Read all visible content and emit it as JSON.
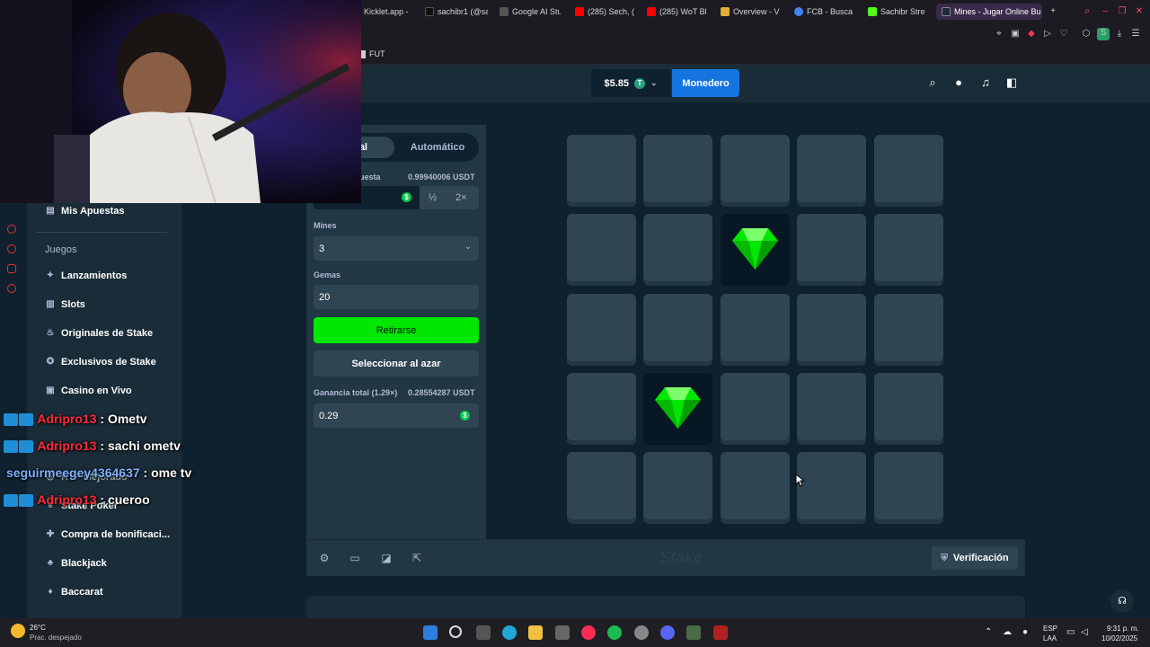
{
  "browser": {
    "tabs": [
      {
        "label": "Kicklet.app -"
      },
      {
        "label": "sachibr1 (@sa"
      },
      {
        "label": "Google AI Stu"
      },
      {
        "label": "(285) Sech, (("
      },
      {
        "label": "(285) WoT Bl"
      },
      {
        "label": "Overview - V"
      },
      {
        "label": "FCB - Busca"
      },
      {
        "label": "Sachibr Stre"
      },
      {
        "label": "Mines - Jugar Online Bu"
      }
    ],
    "bookmark": "FUT"
  },
  "header": {
    "balance": "$5.85",
    "wallet_label": "Monedero"
  },
  "sidebar": {
    "my_bets": "Mis Apuestas",
    "section": "Juegos",
    "items": [
      {
        "label": "Lanzamientos"
      },
      {
        "label": "Slots"
      },
      {
        "label": "Originales de Stake"
      },
      {
        "label": "Exclusivos de Stake"
      },
      {
        "label": "Casino en Vivo"
      },
      {
        "label": "RTP Mejorado"
      },
      {
        "label": "Stake Poker"
      },
      {
        "label": "Compra de bonificaci..."
      },
      {
        "label": "Blackjack"
      },
      {
        "label": "Baccarat"
      }
    ]
  },
  "game": {
    "mode_manual": "ual",
    "mode_auto": "Automático",
    "bet_label": "uesta",
    "bet_amount": "0.99940006 USDT",
    "half": "½",
    "double": "2×",
    "mines_label": "Mines",
    "mines_value": "3",
    "gems_label": "Gemas",
    "gems_value": "20",
    "cashout": "Retirarse",
    "random": "Seleccionar al azar",
    "profit_label": "Ganancia total (1.29×)",
    "profit_amount": "0.28554287 USDT",
    "profit_value": "0.29",
    "verify": "Verificación",
    "watermark": "Stake",
    "grid": [
      [
        0,
        0,
        0,
        0,
        0
      ],
      [
        0,
        0,
        1,
        0,
        0
      ],
      [
        0,
        0,
        0,
        0,
        0
      ],
      [
        0,
        1,
        0,
        0,
        0
      ],
      [
        0,
        0,
        0,
        0,
        0
      ]
    ]
  },
  "chat": [
    {
      "user": "Adripro13",
      "msg": "Ometv"
    },
    {
      "user": "Adripro13",
      "msg": "sachi ometv"
    },
    {
      "user": "seguirmeegey4364637",
      "msg": "ome tv"
    },
    {
      "user": "Adripro13",
      "msg": "cueroo"
    }
  ],
  "taskbar": {
    "temp": "26°C",
    "weather": "Prac. despejado",
    "lang1": "ESP",
    "lang2": "LAA",
    "time": "9:31 p. m.",
    "date": "10/02/2025"
  },
  "colors": {
    "accent_green": "#00e701",
    "wallet_blue": "#1475e1",
    "gem": "#00e701"
  }
}
